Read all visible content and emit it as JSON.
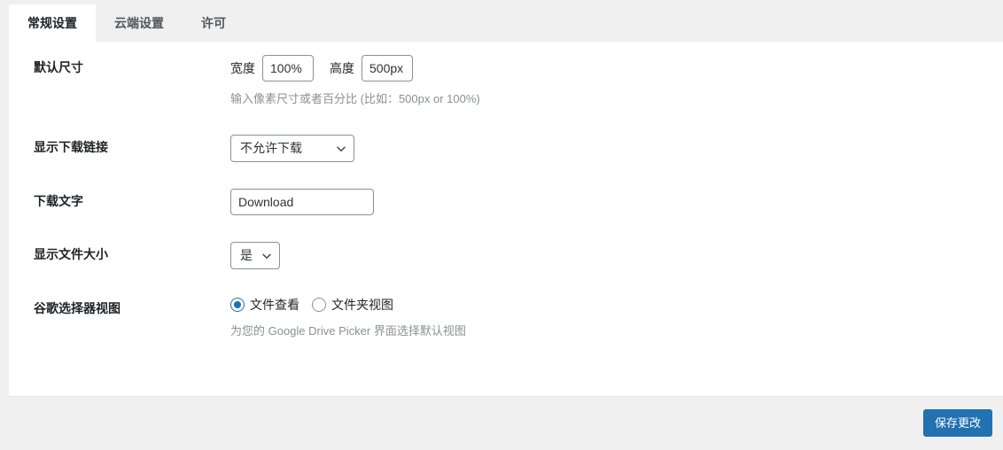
{
  "tabs": [
    {
      "label": "常规设置",
      "active": true
    },
    {
      "label": "云端设置",
      "active": false
    },
    {
      "label": "许可",
      "active": false
    }
  ],
  "settings": {
    "default_size": {
      "label": "默认尺寸",
      "width_label": "宽度",
      "width_value": "100%",
      "height_label": "高度",
      "height_value": "500px",
      "help": "输入像素尺寸或者百分比 (比如：500px or 100%)"
    },
    "show_download_link": {
      "label": "显示下载链接",
      "selected": "不允许下载",
      "icon": "chevron-down-icon"
    },
    "download_text": {
      "label": "下载文字",
      "value": "Download"
    },
    "show_file_size": {
      "label": "显示文件大小",
      "selected": "是",
      "icon": "chevron-down-icon"
    },
    "picker_view": {
      "label": "谷歌选择器视图",
      "options": [
        {
          "label": "文件查看",
          "checked": true
        },
        {
          "label": "文件夹视图",
          "checked": false
        }
      ],
      "help": "为您的 Google Drive Picker 界面选择默认视图"
    }
  },
  "footer": {
    "save_label": "保存更改"
  },
  "colors": {
    "accent": "#2271b1",
    "page_bg": "#f0f0f1",
    "panel_bg": "#ffffff",
    "text": "#1d2327",
    "muted": "#8c8f94"
  }
}
